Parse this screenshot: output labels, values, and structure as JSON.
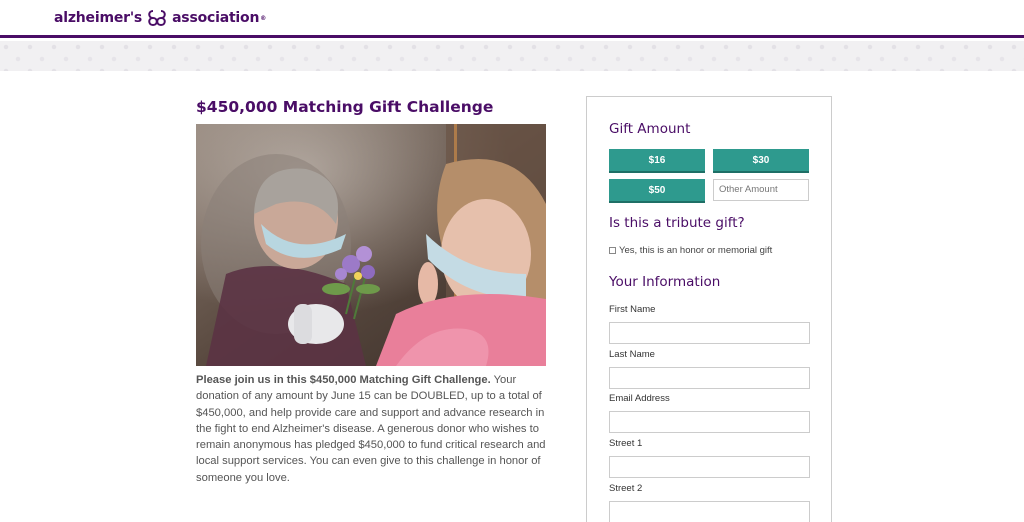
{
  "header": {
    "logo_left": "alzheimer's",
    "logo_right": "association",
    "logo_mark": "®",
    "brand_color": "#4a0d66"
  },
  "main": {
    "title": "$450,000 Matching Gift Challenge",
    "photo_alt": "",
    "desc_bold": "Please join us in this $450,000 Matching Gift Challenge.",
    "desc_rest": " Your donation of any amount by June 15 can be DOUBLED, up to a total of $450,000, and help provide care and support and advance research in the fight to end Alzheimer's disease. A generous donor who wishes to remain anonymous has pledged $450,000 to fund critical research and local support services. You can even give to this challenge in honor of someone you love."
  },
  "form": {
    "gift_heading": "Gift Amount",
    "amounts": [
      "$16",
      "$30",
      "$50"
    ],
    "other_placeholder": "Other Amount",
    "tribute_heading": "Is this a tribute gift?",
    "tribute_label": "Yes, this is an honor or memorial gift",
    "info_heading": "Your Information",
    "fields": [
      "First Name",
      "Last Name",
      "Email Address",
      "Street 1",
      "Street 2"
    ],
    "accent_color": "#2e9a8e"
  }
}
